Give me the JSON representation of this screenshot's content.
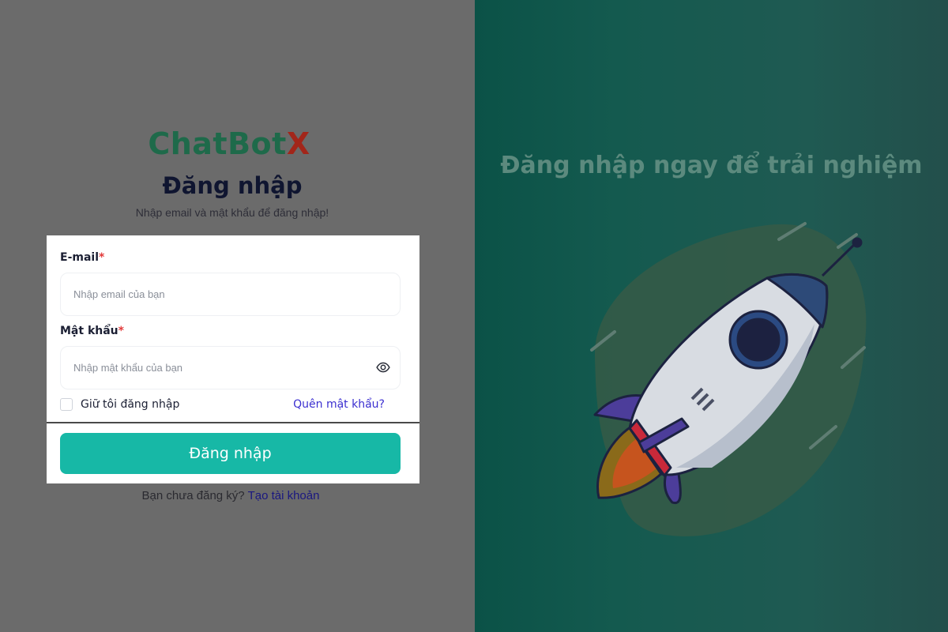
{
  "brand": {
    "part1": "ChatBot",
    "part2": "X"
  },
  "login": {
    "title": "Đăng nhập",
    "subtitle": "Nhập email và mật khẩu để đăng nhập!",
    "email_label": "E-mail",
    "email_placeholder": "Nhập email của bạn",
    "password_label": "Mật khẩu",
    "password_placeholder": "Nhập mật khẩu của bạn",
    "required_mark": "*",
    "remember_label": "Giữ tôi đăng nhập",
    "forgot_label": "Quên mật khẩu?",
    "submit_label": "Đăng nhập",
    "signup_prompt": "Bạn chưa đăng ký?",
    "signup_link": "Tạo tài khoản"
  },
  "promo": {
    "title": "Đăng nhập ngay để trải nghiệm"
  },
  "icons": {
    "password_toggle": "eye-icon",
    "illustration": "rocket-illustration"
  },
  "colors": {
    "brand_green": "#1e6a4a",
    "brand_red": "#a2261a",
    "primary_button": "#17b8a6",
    "link": "#3b2fd0",
    "promo_panel": "#145a4f"
  }
}
